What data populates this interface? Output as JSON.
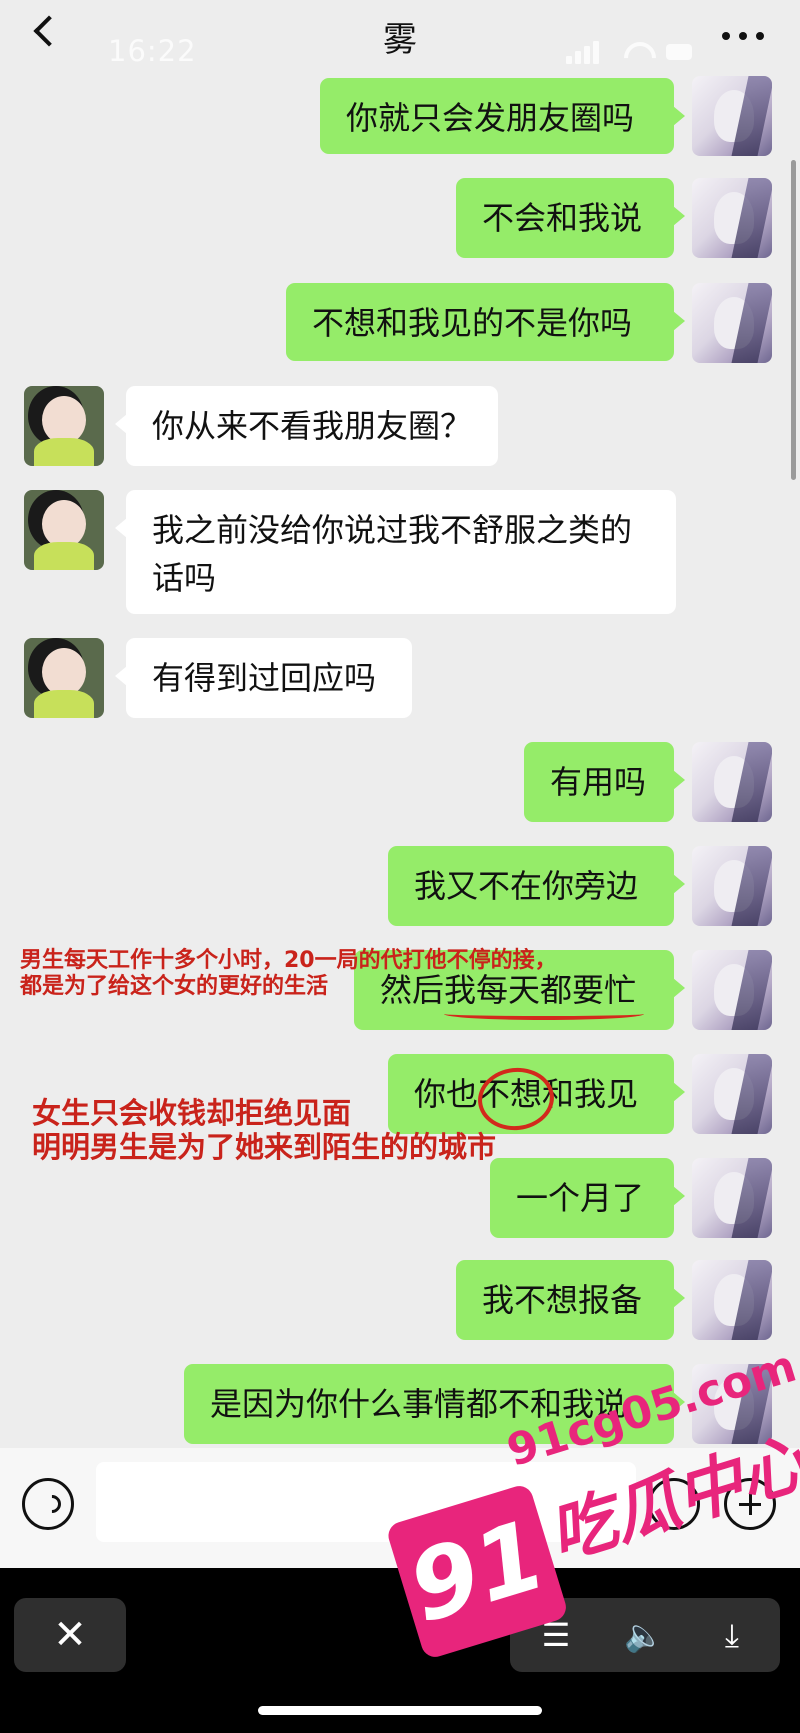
{
  "header": {
    "status_time": "16:22",
    "chat_title": "雾"
  },
  "messages": [
    {
      "side": "out",
      "text": "你就只会发朋友圈吗"
    },
    {
      "side": "out",
      "text": "不会和我说"
    },
    {
      "side": "out",
      "text": "不想和我见的不是你吗"
    },
    {
      "side": "in",
      "text": "你从来不看我朋友圈？"
    },
    {
      "side": "in",
      "text": "我之前没给你说过我不舒服之类的\n话吗"
    },
    {
      "side": "in",
      "text": "有得到过回应吗"
    },
    {
      "side": "out",
      "text": "有用吗"
    },
    {
      "side": "out",
      "text": "我又不在你旁边"
    },
    {
      "side": "out",
      "text": "然后我每天都要忙"
    },
    {
      "side": "out",
      "text": "你也不想和我见"
    },
    {
      "side": "out",
      "text": "一个月了"
    },
    {
      "side": "out",
      "text": "我不想报备"
    },
    {
      "side": "out",
      "text": "是因为你什么事情都不和我说"
    }
  ],
  "annotations": {
    "note1_line1": "男生每天工作十多个小时，20一局的代打他不停的接，",
    "note1_line2": "都是为了给这个女的更好的生活",
    "note2_line1": "女生只会收钱却拒绝见面",
    "note2_line2": "明明男生是为了她来到陌生的的城市"
  },
  "watermark": {
    "badge": "91",
    "url": "91cg05.com",
    "name": "吃瓜中心"
  },
  "bottom_bar": {
    "close_glyph": "✕",
    "menu_glyph": "☰",
    "volume_glyph": "🔈",
    "download_glyph": "⤓"
  },
  "colors": {
    "outgoing_bubble": "#95ec69",
    "incoming_bubble": "#ffffff",
    "annotation_red": "#c9231b",
    "watermark_pink": "#e8257c"
  }
}
